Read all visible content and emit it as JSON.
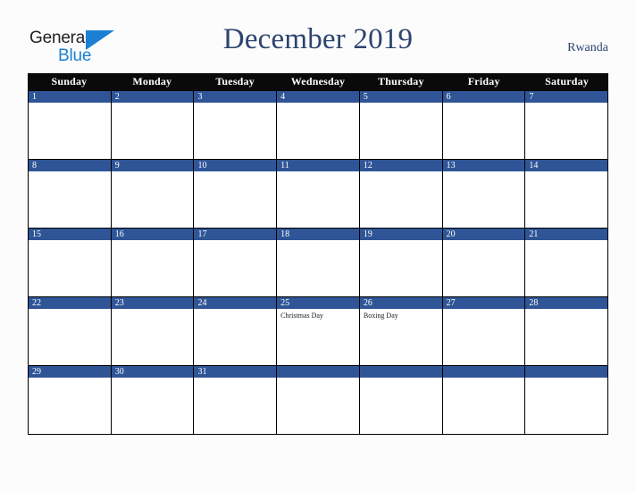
{
  "brand": {
    "name_part1": "General",
    "name_part2": "Blue",
    "triangle_color": "#1b7fd4",
    "text_color": "#231f20"
  },
  "header": {
    "title": "December 2019",
    "region": "Rwanda",
    "title_color": "#2c4470"
  },
  "calendar": {
    "header_background": "#0a0a0a",
    "date_band_color": "#2f5597",
    "border_color": "#000000",
    "cell_background": "#ffffff",
    "day_names": [
      "Sunday",
      "Monday",
      "Tuesday",
      "Wednesday",
      "Thursday",
      "Friday",
      "Saturday"
    ],
    "weeks": [
      [
        {
          "date": "1",
          "events": []
        },
        {
          "date": "2",
          "events": []
        },
        {
          "date": "3",
          "events": []
        },
        {
          "date": "4",
          "events": []
        },
        {
          "date": "5",
          "events": []
        },
        {
          "date": "6",
          "events": []
        },
        {
          "date": "7",
          "events": []
        }
      ],
      [
        {
          "date": "8",
          "events": []
        },
        {
          "date": "9",
          "events": []
        },
        {
          "date": "10",
          "events": []
        },
        {
          "date": "11",
          "events": []
        },
        {
          "date": "12",
          "events": []
        },
        {
          "date": "13",
          "events": []
        },
        {
          "date": "14",
          "events": []
        }
      ],
      [
        {
          "date": "15",
          "events": []
        },
        {
          "date": "16",
          "events": []
        },
        {
          "date": "17",
          "events": []
        },
        {
          "date": "18",
          "events": []
        },
        {
          "date": "19",
          "events": []
        },
        {
          "date": "20",
          "events": []
        },
        {
          "date": "21",
          "events": []
        }
      ],
      [
        {
          "date": "22",
          "events": []
        },
        {
          "date": "23",
          "events": []
        },
        {
          "date": "24",
          "events": []
        },
        {
          "date": "25",
          "events": [
            "Christmas Day"
          ]
        },
        {
          "date": "26",
          "events": [
            "Boxing Day"
          ]
        },
        {
          "date": "27",
          "events": []
        },
        {
          "date": "28",
          "events": []
        }
      ],
      [
        {
          "date": "29",
          "events": []
        },
        {
          "date": "30",
          "events": []
        },
        {
          "date": "31",
          "events": []
        },
        {
          "date": "",
          "events": []
        },
        {
          "date": "",
          "events": []
        },
        {
          "date": "",
          "events": []
        },
        {
          "date": "",
          "events": []
        }
      ]
    ]
  }
}
